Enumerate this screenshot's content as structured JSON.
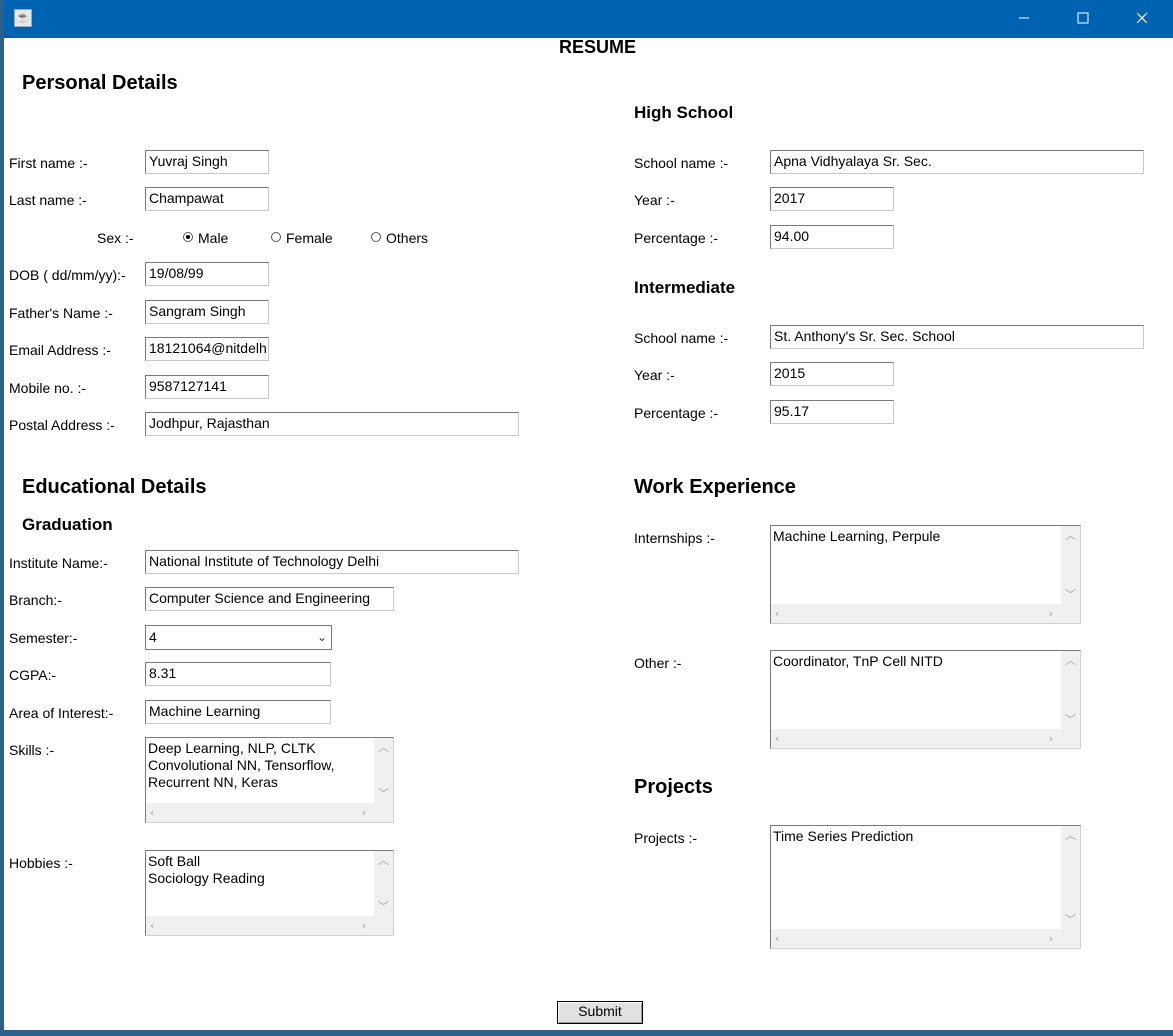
{
  "window": {
    "title_icon": "java-coffee-icon",
    "minimize_icon": "minimize-icon",
    "maximize_icon": "maximize-icon",
    "close_icon": "close-icon"
  },
  "page_title": "RESUME",
  "personal": {
    "heading": "Personal Details",
    "first_name_label": "First name :-",
    "first_name": "Yuvraj Singh",
    "last_name_label": "Last name :-",
    "last_name": "Champawat",
    "sex_label": "Sex :-",
    "sex_options": [
      "Male",
      "Female",
      "Others"
    ],
    "sex_selected": "Male",
    "dob_label": "DOB ( dd/mm/yy):-",
    "dob": "19/08/99",
    "father_label": "Father's Name :-",
    "father": "Sangram Singh",
    "email_label": "Email Address :-",
    "email": "18121064@nitdelh",
    "mobile_label": "Mobile no. :-",
    "mobile": "9587127141",
    "postal_label": "Postal Address :-",
    "postal": "Jodhpur, Rajasthan"
  },
  "education": {
    "heading": "Educational Details",
    "graduation_heading": "Graduation",
    "institute_label": "Institute Name:-",
    "institute": "National Institute of Technology Delhi",
    "branch_label": "Branch:-",
    "branch": "Computer Science and Engineering",
    "semester_label": "Semester:-",
    "semester": "4",
    "cgpa_label": "CGPA:-",
    "cgpa": "8.31",
    "interest_label": "Area of Interest:-",
    "interest": "Machine Learning",
    "skills_label": "Skills :-",
    "skills": "Deep Learning, NLP, CLTK\nConvolutional NN, Tensorflow,\nRecurrent NN, Keras",
    "hobbies_label": "Hobbies :-",
    "hobbies": "Soft Ball\nSociology Reading"
  },
  "high_school": {
    "heading": "High School",
    "school_label": "School name :-",
    "school": "Apna Vidhyalaya Sr. Sec.",
    "year_label": "Year :-",
    "year": "2017",
    "percentage_label": "Percentage :-",
    "percentage": "94.00"
  },
  "intermediate": {
    "heading": "Intermediate",
    "school_label": "School name :-",
    "school": "St. Anthony's Sr. Sec. School",
    "year_label": "Year :-",
    "year": "2015",
    "percentage_label": "Percentage :-",
    "percentage": "95.17"
  },
  "work": {
    "heading": "Work Experience",
    "internships_label": "Internships :-",
    "internships": "Machine Learning, Perpule",
    "other_label": "Other :-",
    "other": "Coordinator, TnP Cell NITD"
  },
  "projects": {
    "heading": "Projects",
    "projects_label": "Projects :-",
    "projects": "Time Series Prediction"
  },
  "submit_label": "Submit"
}
